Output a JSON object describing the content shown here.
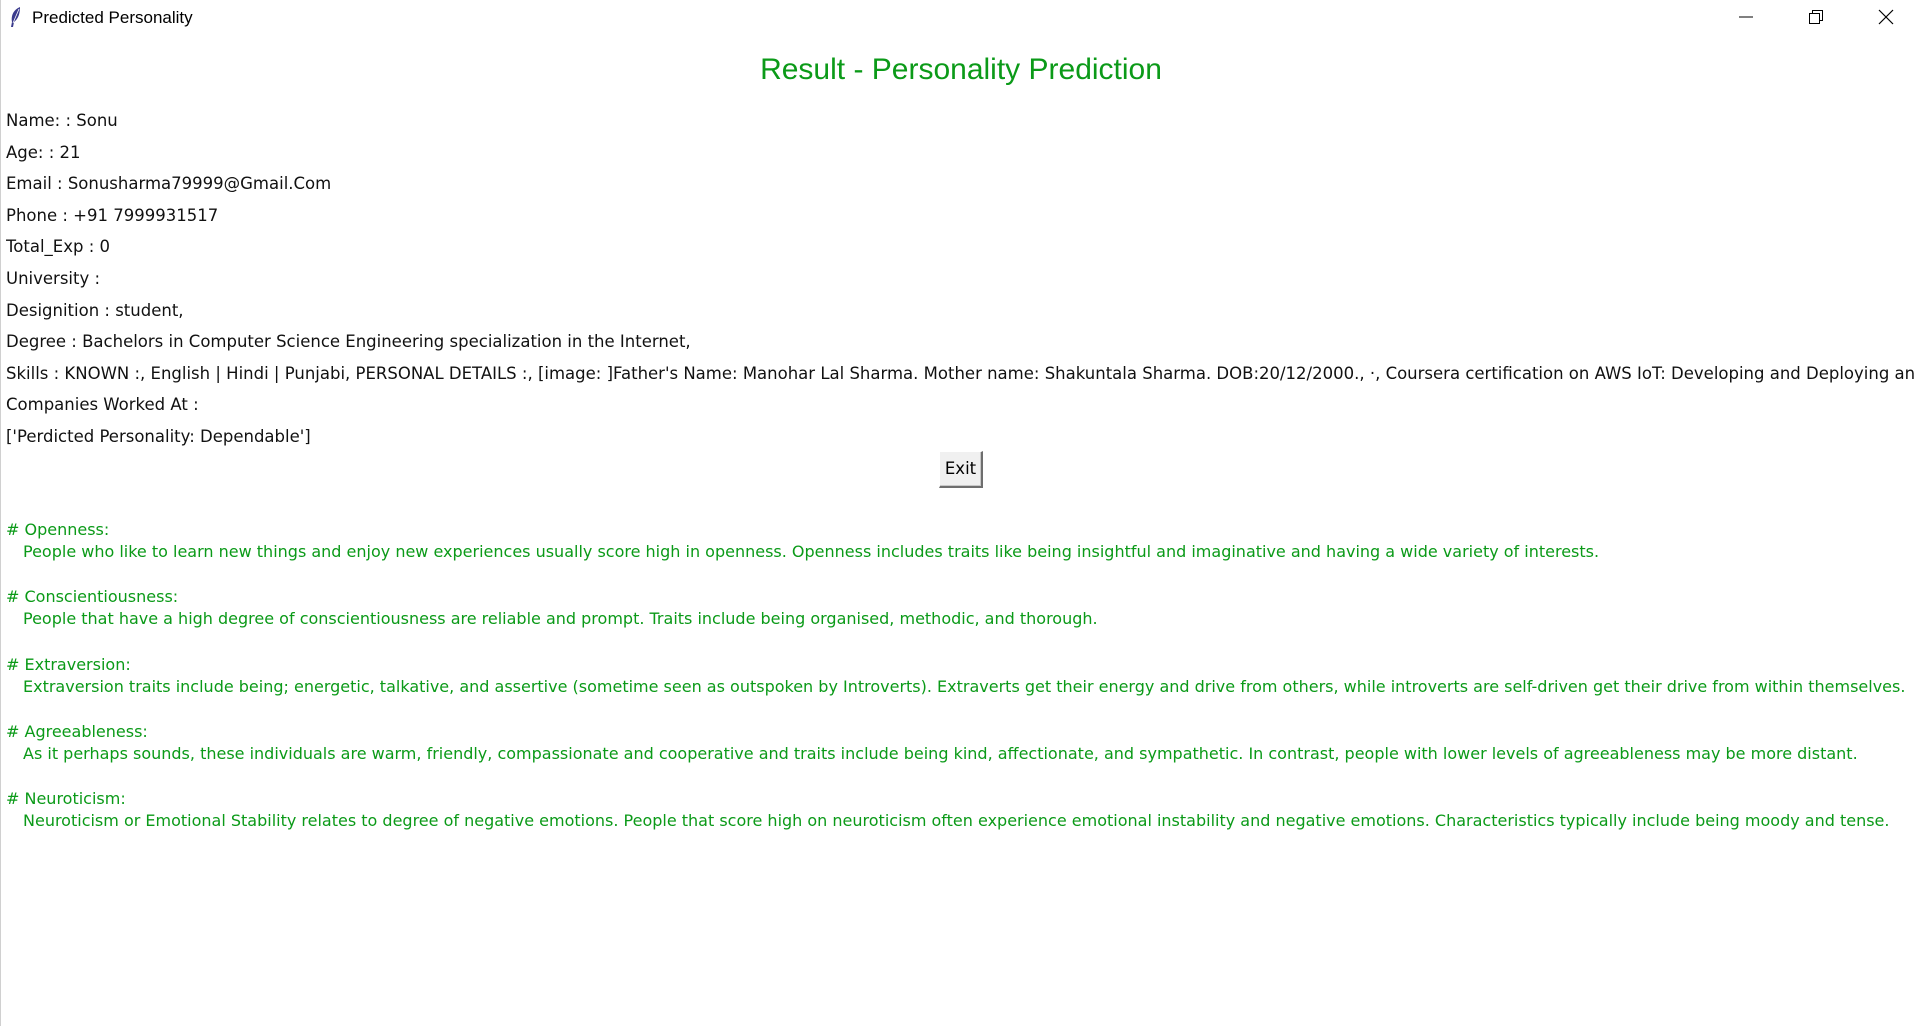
{
  "window": {
    "title": "Predicted Personality",
    "icon": "feather-icon",
    "controls": [
      "minimize-icon",
      "restore-icon",
      "close-icon"
    ]
  },
  "heading": "Result - Personality Prediction",
  "info": [
    "Name: : Sonu",
    "Age: : 21",
    "Email : Sonusharma79999@Gmail.Com",
    "Phone : +91 7999931517",
    "Total_Exp : 0",
    "University : ",
    "Designition : student,",
    "Degree : Bachelors in Computer Science Engineering specialization in the Internet,",
    "Skills : KNOWN :, English | Hindi | Punjabi, PERSONAL DETAILS :, [image: ]Father's Name: Manohar Lal Sharma. Mother name: Shakuntala Sharma. DOB:20/12/2000., ·, Coursera certification on AWS IoT: Developing and Deploying an Internet of T",
    "Companies Worked At : ",
    "['Perdicted Personality: Dependable']"
  ],
  "exit_label": "Exit",
  "traits": [
    {
      "heading": "# Openness:",
      "description": "People who like to learn new things and enjoy new experiences usually score high in openness. Openness includes traits like being insightful and imaginative and having a wide variety of interests."
    },
    {
      "heading": "# Conscientiousness:",
      "description": "People that have a high degree of conscientiousness are reliable and prompt. Traits include being organised, methodic, and thorough."
    },
    {
      "heading": "# Extraversion:",
      "description": "Extraversion traits include being; energetic, talkative, and assertive (sometime seen as outspoken by Introverts). Extraverts get their energy and drive from others, while introverts are self-driven get their drive from within themselves."
    },
    {
      "heading": "# Agreeableness:",
      "description": "As it perhaps sounds, these individuals are warm, friendly, compassionate and cooperative and traits include being kind, affectionate, and sympathetic. In contrast, people with lower levels of agreeableness may be more distant."
    },
    {
      "heading": "# Neuroticism:",
      "description": "Neuroticism or Emotional Stability relates to degree of negative emotions. People that score high on neuroticism often experience emotional instability and negative emotions. Characteristics typically include being moody and tense."
    }
  ],
  "colors": {
    "accent_green": "#0b9a18",
    "text": "#111111",
    "button_face": "#f0f0f0"
  }
}
